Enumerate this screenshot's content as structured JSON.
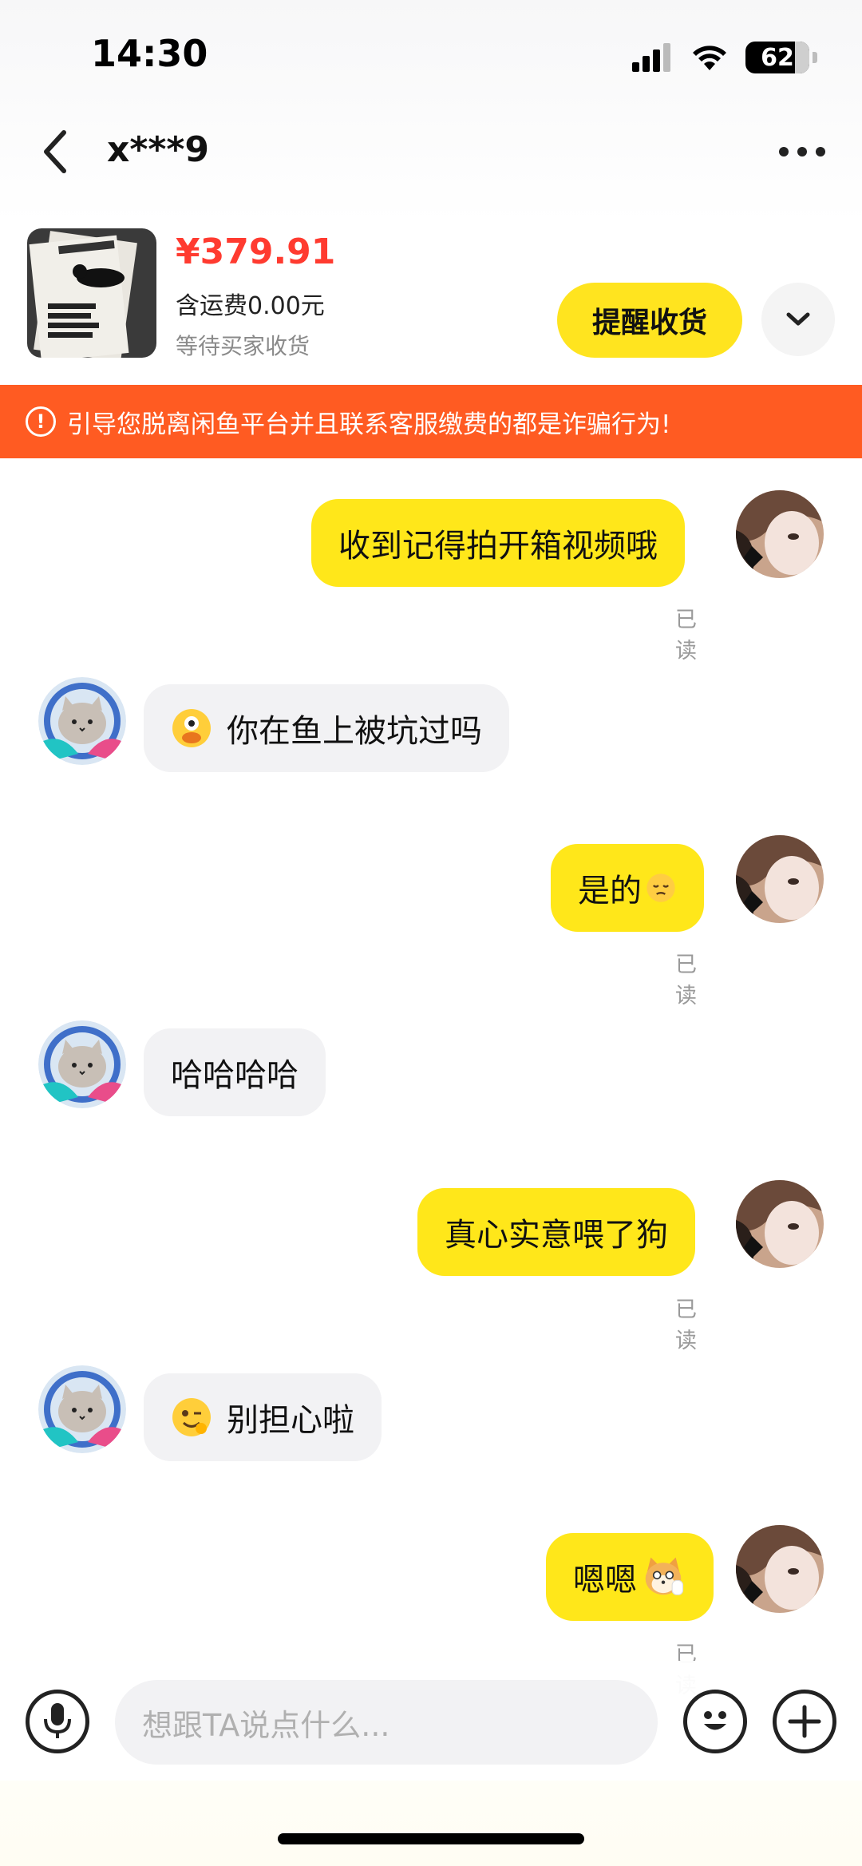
{
  "status_bar": {
    "time": "14:30",
    "battery": "62"
  },
  "header": {
    "title": "x***9"
  },
  "product": {
    "price": "¥379.91",
    "shipping": "含运费0.00元",
    "status": "等待买家收货",
    "remind_button": "提醒收货"
  },
  "warning": {
    "text": "引导您脱离闲鱼平台并且联系客服缴费的都是诈骗行为!"
  },
  "messages": [
    {
      "sender": "me",
      "text": "收到记得拍开箱视频哦",
      "read": "已读"
    },
    {
      "sender": "them",
      "text": "你在鱼上被坑过吗",
      "emoji": "dizzy-face-emoji"
    },
    {
      "sender": "me",
      "text": "是的",
      "emoji": "pensive-face-emoji",
      "read": "已读"
    },
    {
      "sender": "them",
      "text": "哈哈哈哈"
    },
    {
      "sender": "me",
      "text": "真心实意喂了狗",
      "read": "已读"
    },
    {
      "sender": "them",
      "text": "别担心啦",
      "emoji": "winking-face-emoji"
    },
    {
      "sender": "me",
      "text": "嗯嗯",
      "emoji": "shiba-dog-sticker",
      "read": "已读"
    }
  ],
  "input": {
    "placeholder": "想跟TA说点什么..."
  },
  "colors": {
    "accent": "#ffe41f",
    "price": "#ff3b30",
    "warning_bg": "#ff5b22",
    "bubble_them": "#f2f2f4"
  }
}
